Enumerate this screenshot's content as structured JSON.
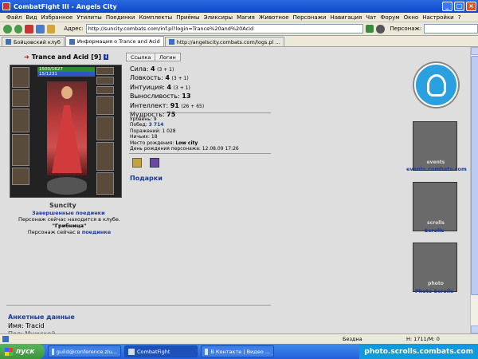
{
  "window": {
    "title": "CombatFight III - Angels City"
  },
  "menu": [
    "Файл",
    "Вид",
    "Избранное",
    "Утилиты",
    "Поединки",
    "Комплекты",
    "Приёмы",
    "Эликсиры",
    "Магия",
    "Животное",
    "Персонажи",
    "Навигация",
    "Чат",
    "Форум",
    "Окно",
    "Настройки",
    "?"
  ],
  "address": {
    "label": "Адрес:",
    "value": "http://suncity.combats.com/inf.pl?login=Trance%20and%20Acid",
    "persona_label": "Персонаж:"
  },
  "tabs": [
    {
      "label": "Бойцовский клуб",
      "active": false
    },
    {
      "label": "Информация о Trance and Acid",
      "active": true
    },
    {
      "label": "http://angelscity.combats.com/logs.pl ...",
      "active": false
    }
  ],
  "character": {
    "name": "Trance and Acid",
    "level": "[9]",
    "clan_badge": "i",
    "hp": "1500/1627",
    "mp": "15/1231",
    "city": "Suncity",
    "link_button": "Ссылка",
    "login_button": "Логин",
    "fights_link": "Завершенные поединки",
    "status_line1": "Персонаж сейчас находится в клубе.",
    "status_room": "\"Грибница\"",
    "status_line2_prefix": "Персонаж сейчас в",
    "status_line2_link": "поединке"
  },
  "stats": [
    {
      "label": "Сила:",
      "value": "4",
      "extra": "(3 + 1)"
    },
    {
      "label": "Ловкость:",
      "value": "4",
      "extra": "(3 + 1)"
    },
    {
      "label": "Интуиция:",
      "value": "4",
      "extra": "(3 + 1)"
    },
    {
      "label": "Выносливость:",
      "value": "13",
      "extra": ""
    },
    {
      "label": "Интеллект:",
      "value": "91",
      "extra": "(26 + 65)"
    },
    {
      "label": "Мудрость:",
      "value": "75",
      "extra": ""
    }
  ],
  "info": {
    "level": "Уровень: 9",
    "wins_label": "Побед:",
    "wins": "3 714",
    "losses": "Поражений: 1 028",
    "draws": "Ничьих: 18",
    "birthplace_label": "Место рождения:",
    "birthplace": "Low city",
    "birthday": "День рождения персонажа: 12.08.09 17:26"
  },
  "gifts": "Подарки",
  "anketa": {
    "title": "Анкетные данные",
    "name": "Имя: Tracid",
    "gender": "Пол: Мужской"
  },
  "right_panel": [
    {
      "label": "events.combats.com",
      "banner": "events"
    },
    {
      "label": "Scrolls",
      "banner": "scrolls"
    },
    {
      "label": "Photo Scrolls",
      "banner": "photo"
    }
  ],
  "statusbar": {
    "zone": "Бездна",
    "hp": "H: 1711/M: 0"
  },
  "taskbar": {
    "start": "пуск",
    "tasks": [
      {
        "label": "guild@conference.zlu...",
        "active": false
      },
      {
        "label": "CombatFight",
        "active": true
      },
      {
        "label": "В Контакте | Видео ...",
        "active": false
      }
    ],
    "watermark": "photo.scrolls.combats.com"
  }
}
